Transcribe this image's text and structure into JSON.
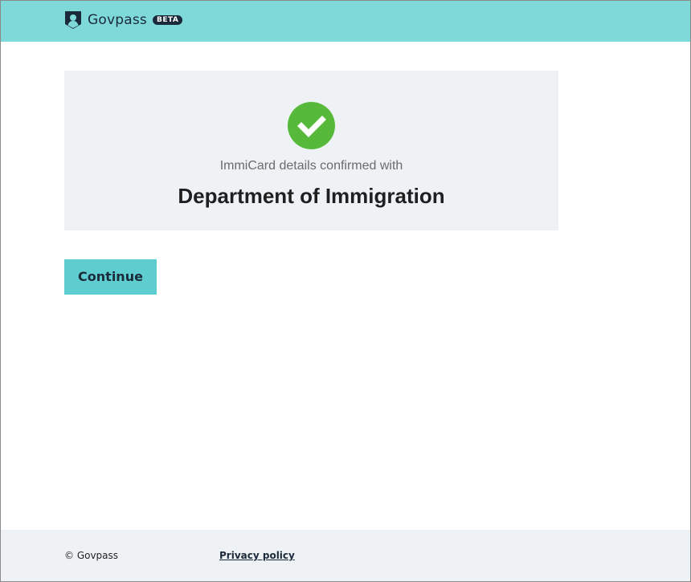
{
  "header": {
    "brand": "Govpass",
    "badge": "BETA",
    "logo_icon": "shield-person-icon",
    "background_color": "#7ed9d8"
  },
  "confirmation": {
    "status_icon": "check-circle-icon",
    "status_color": "#56b93a",
    "message": "ImmiCard details confirmed with",
    "organisation": "Department of Immigration"
  },
  "actions": {
    "continue_label": "Continue",
    "continue_color": "#5ecdcf"
  },
  "footer": {
    "copyright": "© Govpass",
    "privacy_link": "Privacy policy"
  }
}
